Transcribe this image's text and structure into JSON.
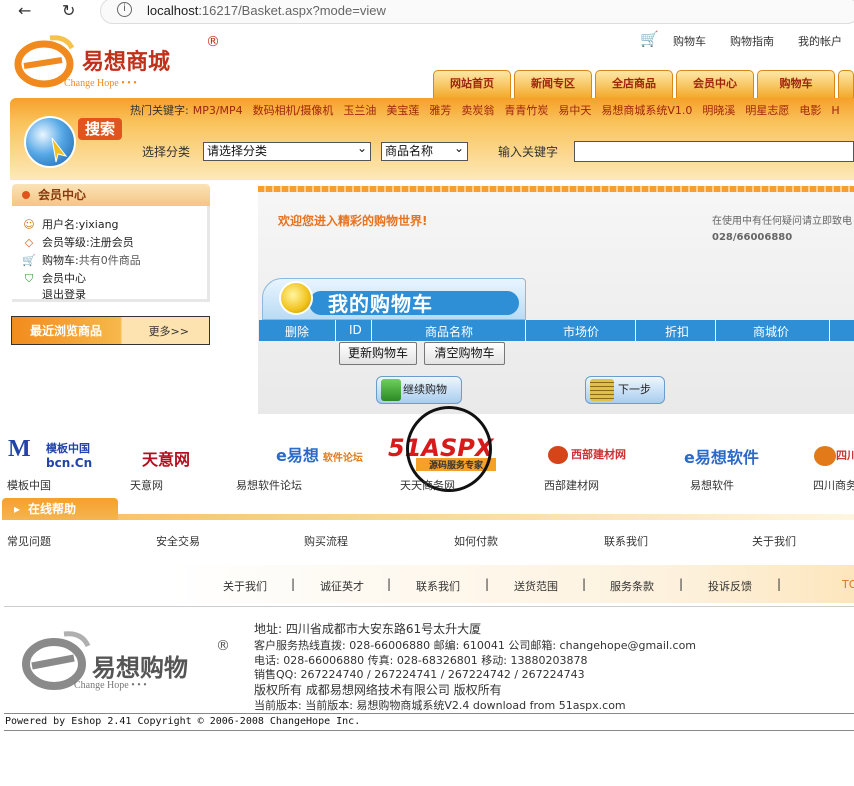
{
  "browser": {
    "url_host": "localhost",
    "url_rest": ":16217/Basket.aspx?mode=view"
  },
  "brand": {
    "name": "易想商城",
    "tagline": "Change Hope",
    "accent": "#f6a02a",
    "red": "#a0250e",
    "blue": "#2e8fd7"
  },
  "toplinks": {
    "cart": "购物车",
    "guide": "购物指南",
    "account": "我的帐户"
  },
  "tabs": [
    "网站首页",
    "新闻专区",
    "全店商品",
    "会员中心",
    "购物车"
  ],
  "search": {
    "hot_label": "热门关键字:",
    "hot_words": [
      "MP3/MP4",
      "数码相机/摄像机",
      "玉兰油",
      "美宝莲",
      "雅芳",
      "卖炭翁",
      "青青竹炭",
      "易中天",
      "易想商城系统V1.0",
      "明晓溪",
      "明星志愿",
      "电影",
      "H"
    ],
    "tag": "搜索",
    "category_label": "选择分类",
    "category_value": "请选择分类",
    "field_value": "商品名称",
    "keyword_label": "输入关键字",
    "keyword_value": ""
  },
  "member": {
    "title": "会员中心",
    "username": "用户名:yixiang",
    "level": "会员等级:注册会员",
    "cart_label": "购物车:",
    "cart_value": "共有0件商品",
    "center": "会员中心",
    "logout": "退出登录"
  },
  "recent": {
    "title": "最近浏览商品",
    "more": "更多>>"
  },
  "main": {
    "welcome": "欢迎您进入精彩的购物世界!",
    "contact": "在使用中有任何疑问请立即致电",
    "phone": "028/66006880",
    "cart_title": "我的购物车",
    "columns": [
      "删除",
      "ID",
      "商品名称",
      "市场价",
      "折扣",
      "商城价"
    ],
    "update_btn": "更新购物车",
    "clear_btn": "清空购物车",
    "continue_btn": "继续购物",
    "next_btn": "下一步"
  },
  "partners": [
    {
      "logo": "模板中国",
      "sub": "bcn.Cn",
      "label": "模板中国"
    },
    {
      "logo": "天意网",
      "sub": "",
      "label": "天意网"
    },
    {
      "logo": "e易想",
      "sub": "软件论坛",
      "label": "易想软件论坛"
    },
    {
      "logo": "51ASPX",
      "sub": "源码服务专家",
      "label": "天天商务网"
    },
    {
      "logo": "西部建材网",
      "sub": "",
      "label": "西部建材网"
    },
    {
      "logo": "e易想软件",
      "sub": "",
      "label": "易想软件"
    },
    {
      "logo": "四川",
      "sub": "",
      "label": "四川商务"
    }
  ],
  "help": {
    "title": "在线帮助",
    "links": [
      "常见问题",
      "安全交易",
      "购买流程",
      "如何付款",
      "联系我们",
      "关于我们"
    ]
  },
  "footer_nav": [
    "关于我们",
    "诚征英才",
    "联系我们",
    "送货范围",
    "服务条款",
    "投诉反馈",
    "TO"
  ],
  "footer": {
    "logo_text": "易想购物",
    "logo_tagline": "Change Hope",
    "address": "地址: 四川省成都市大安东路61号太升大厦",
    "hotline": "客户服务热线直拨: 028-66006880 邮编: 610041 公司邮箱: changehope@gmail.com",
    "phones": "电话: 028-66006880 传真: 028-68326801 移动: 13880203878",
    "qq": "销售QQ: 267224740 / 267224741 / 267224742 / 267224743",
    "copyright": "版权所有 成都易想网络技术有限公司 版权所有",
    "version": "当前版本: 当前版本: 易想购物商城系统V2.4 download from 51aspx.com",
    "powered": "Powered by Eshop 2.41 Copyright © 2006-2008 ChangeHope Inc."
  }
}
